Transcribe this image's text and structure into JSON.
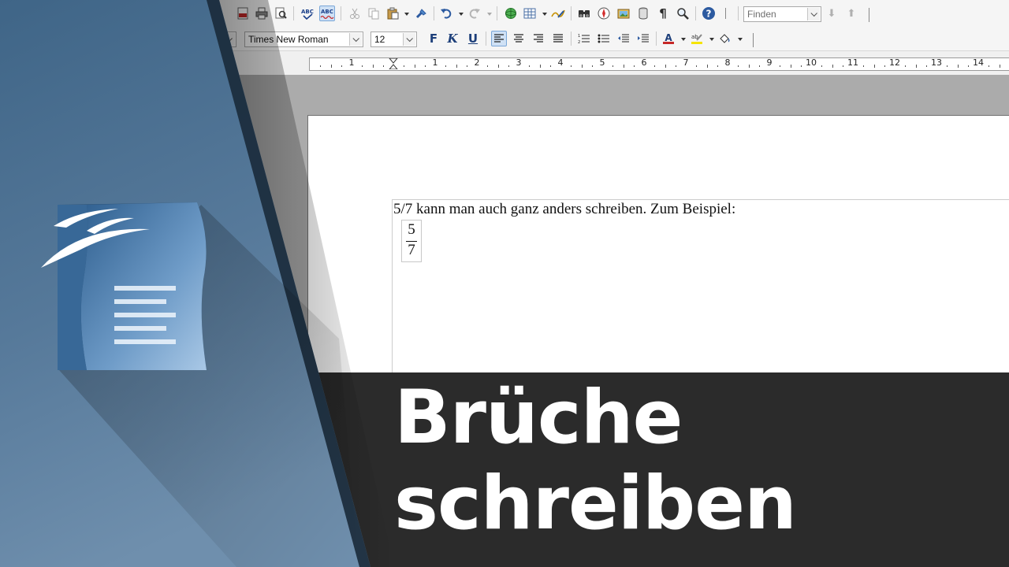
{
  "toolbar": {
    "font_name": "Times New Roman",
    "font_size": "12",
    "find_placeholder": "Finden",
    "bold_label": "F",
    "italic_label": "K",
    "underline_label": "U"
  },
  "ruler": {
    "left_numbers": [
      "1"
    ],
    "numbers": [
      "1",
      "2",
      "3",
      "4",
      "5",
      "6",
      "7",
      "8",
      "9",
      "10",
      "11",
      "12",
      "13",
      "14"
    ]
  },
  "document": {
    "line1": "5/7 kann man auch ganz anders schreiben. Zum Beispiel:",
    "fraction": {
      "numerator": "5",
      "denominator": "7"
    }
  },
  "banner": {
    "line1": "Brüche",
    "line2": "schreiben"
  },
  "colors": {
    "panel_blue": "#4f7596",
    "banner_bg": "#2b2b2b",
    "workspace_gray": "#ababab"
  }
}
